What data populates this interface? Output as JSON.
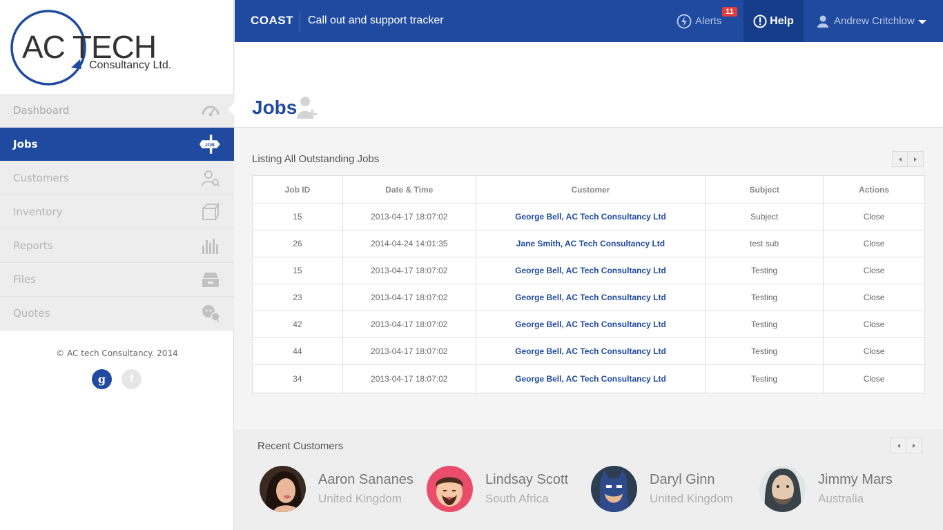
{
  "sidebar": {
    "logo": {
      "main": "AC TECH",
      "sub": "Consultancy Ltd."
    },
    "items": [
      {
        "label": "Dashboard"
      },
      {
        "label": "Jobs"
      },
      {
        "label": "Customers"
      },
      {
        "label": "Inventory"
      },
      {
        "label": "Reports"
      },
      {
        "label": "Files"
      },
      {
        "label": "Quotes"
      }
    ],
    "copyright": "©  AC tech Consultancy. 2014",
    "social": {
      "google": "g",
      "facebook": "f"
    }
  },
  "topbar": {
    "brand": "COAST",
    "title": "Call out and support tracker",
    "alerts_label": "Alerts",
    "alerts_count": "11",
    "help_label": "Help",
    "user_name": "Andrew Critchlow"
  },
  "page": {
    "title": "Jobs"
  },
  "jobs": {
    "title": "Listing All Outstanding Jobs",
    "columns": [
      "Job ID",
      "Date & Time",
      "Customer",
      "Subject",
      "Actions"
    ],
    "rows": [
      {
        "id": "15",
        "date": "2013-04-17 18:07:02",
        "customer": "George Bell, AC Tech Consultancy Ltd",
        "subject": "Subject",
        "action": "Close"
      },
      {
        "id": "26",
        "date": "2014-04-24 14:01:35",
        "customer": "Jane Smith, AC Tech Consultancy Ltd",
        "subject": "test sub",
        "action": "Close"
      },
      {
        "id": "15",
        "date": "2013-04-17 18:07:02",
        "customer": "George Bell, AC Tech Consultancy Ltd",
        "subject": "Testing",
        "action": "Close"
      },
      {
        "id": "23",
        "date": "2013-04-17 18:07:02",
        "customer": "George Bell, AC Tech Consultancy Ltd",
        "subject": "Testing",
        "action": "Close"
      },
      {
        "id": "42",
        "date": "2013-04-17 18:07:02",
        "customer": "George Bell, AC Tech Consultancy Ltd",
        "subject": "Testing",
        "action": "Close"
      },
      {
        "id": "44",
        "date": "2013-04-17 18:07:02",
        "customer": "George Bell, AC Tech Consultancy Ltd",
        "subject": "Testing",
        "action": "Close"
      },
      {
        "id": "34",
        "date": "2013-04-17 18:07:02",
        "customer": "George Bell, AC Tech Consultancy Ltd",
        "subject": "Testing",
        "action": "Close"
      }
    ]
  },
  "recent": {
    "title": "Recent Customers",
    "customers": [
      {
        "name": "Aaron Sananes",
        "location": "United Kingdom"
      },
      {
        "name": "Lindsay Scott",
        "location": "South Africa"
      },
      {
        "name": "Daryl Ginn",
        "location": "United Kingdom"
      },
      {
        "name": "Jimmy Mars",
        "location": "Australia"
      }
    ]
  },
  "colors": {
    "primary": "#1f4aa0",
    "primary_dark": "#163d8a",
    "badge": "#e23c3c"
  }
}
